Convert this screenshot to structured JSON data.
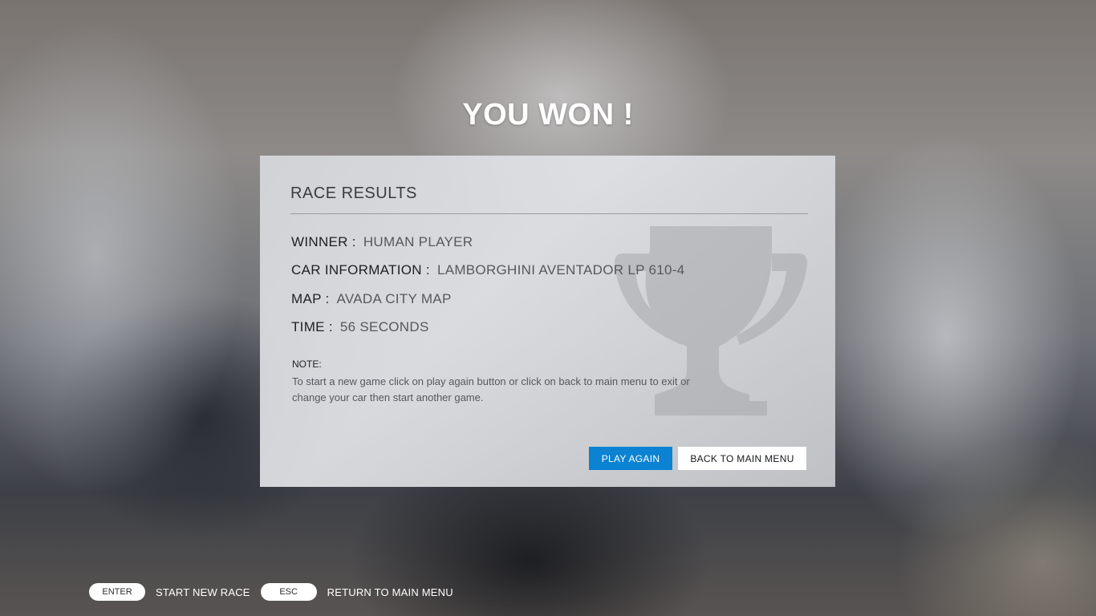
{
  "title": "YOU WON !",
  "panel": {
    "heading": "RACE RESULTS",
    "rows": [
      {
        "label": "WINNER :",
        "value": "HUMAN PLAYER"
      },
      {
        "label": "CAR INFORMATION :",
        "value": "LAMBORGHINI AVENTADOR LP 610-4"
      },
      {
        "label": "MAP :",
        "value": "AVADA CITY MAP"
      },
      {
        "label": "TIME :",
        "value": "56 SECONDS"
      }
    ],
    "note_title": "NOTE:",
    "note_text": "To start a new game click on play again button or click on back to main menu to exit or change your car then start another game.",
    "buttons": {
      "play_again": "PLAY AGAIN",
      "back_to_menu": "BACK TO MAIN MENU"
    },
    "decor_icon": "trophy-icon"
  },
  "footer": [
    {
      "key": "ENTER",
      "hint": "START NEW RACE"
    },
    {
      "key": "ESC",
      "hint": "RETURN TO MAIN MENU"
    }
  ],
  "colors": {
    "accent": "#0b82d2",
    "title": "#ffffff",
    "panel": "#d8dadd"
  }
}
